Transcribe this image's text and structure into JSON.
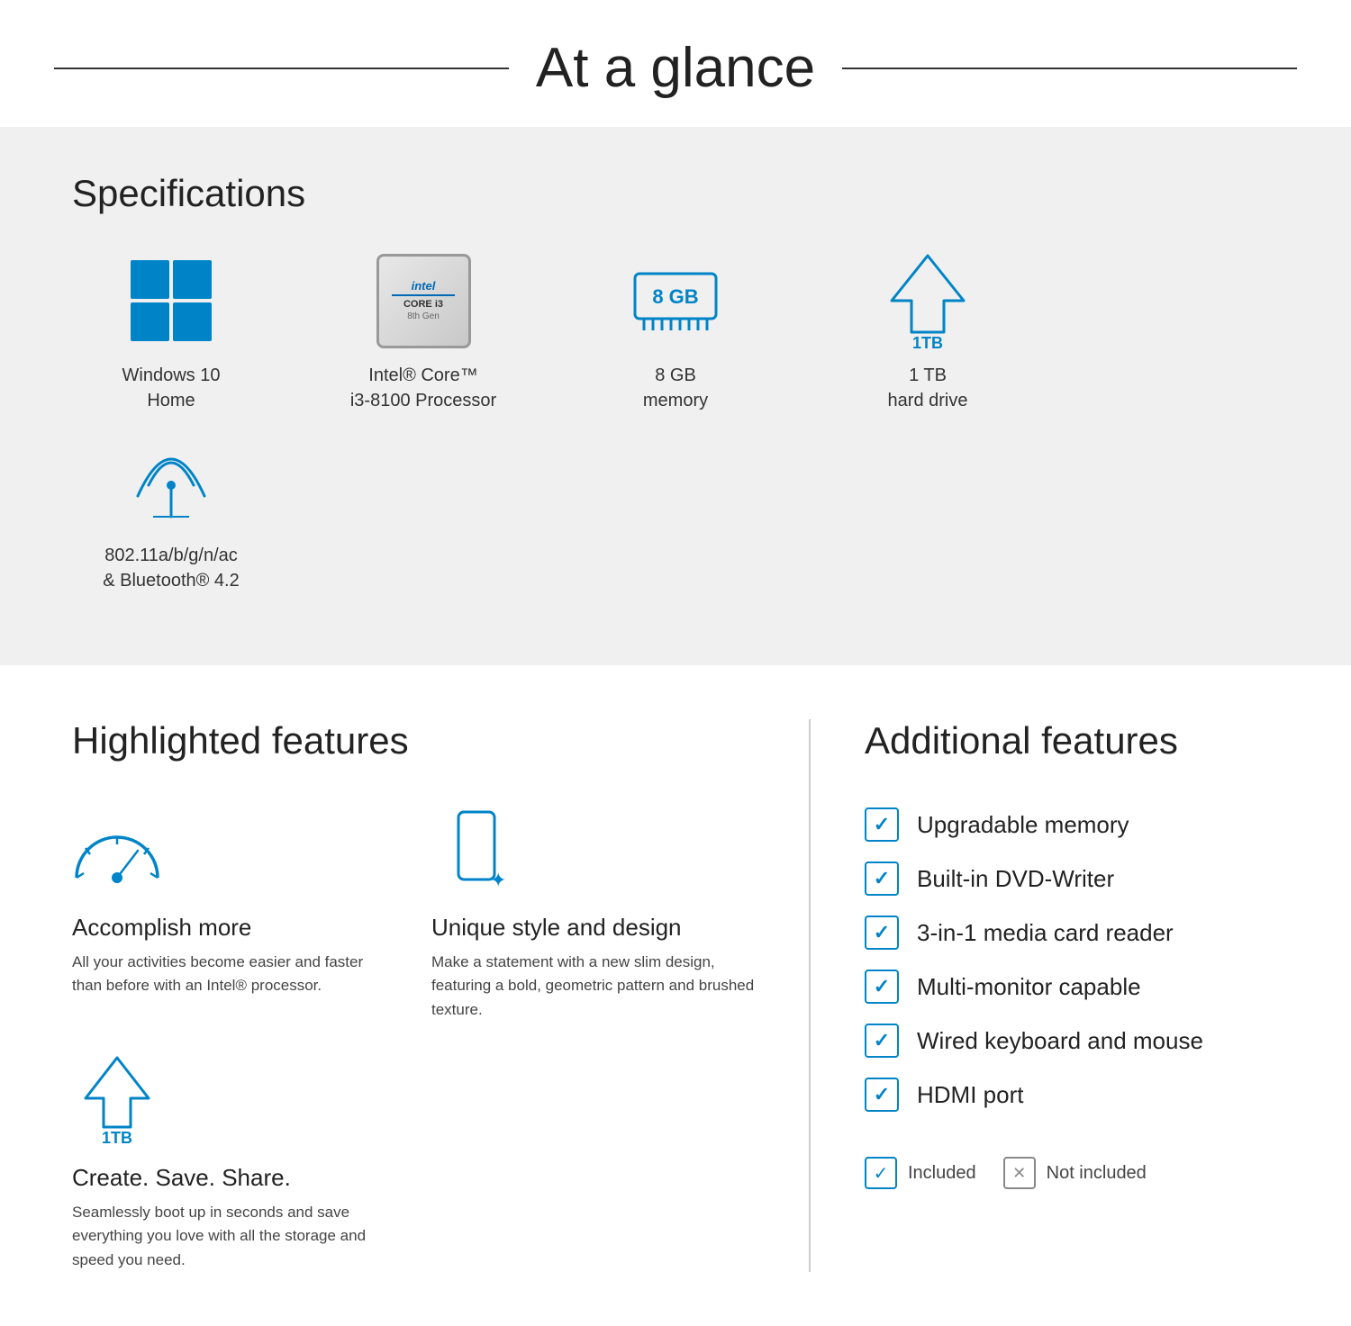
{
  "header": {
    "title": "At a glance"
  },
  "specs": {
    "section_title": "Specifications",
    "items": [
      {
        "id": "windows",
        "label": "Windows 10\nHome",
        "icon": "windows-icon"
      },
      {
        "id": "processor",
        "label": "Intel® Core™\ni3-8100 Processor",
        "icon": "intel-icon"
      },
      {
        "id": "memory",
        "label": "8 GB\nmemory",
        "icon": "ram-icon"
      },
      {
        "id": "storage",
        "label": "1 TB\nhard drive",
        "icon": "hdd-icon"
      },
      {
        "id": "wifi",
        "label": "802.11a/b/g/n/ac\n& Bluetooth® 4.2",
        "icon": "wifi-icon"
      }
    ]
  },
  "highlighted": {
    "section_title": "Highlighted features",
    "items": [
      {
        "id": "accomplish",
        "name": "Accomplish more",
        "desc": "All your activities become easier and faster than before with an Intel® processor.",
        "icon": "speedometer-icon"
      },
      {
        "id": "style",
        "name": "Unique style and design",
        "desc": "Make a statement with a new slim design, featuring a bold, geometric pattern and brushed texture.",
        "icon": "phone-icon"
      },
      {
        "id": "storage_feature",
        "name": "Create. Save. Share.",
        "desc": "Seamlessly boot up in seconds and save everything you love with all the storage and speed you need.",
        "icon": "tb-icon"
      }
    ]
  },
  "additional": {
    "section_title": "Additional features",
    "items": [
      "Upgradable memory",
      "Built-in DVD-Writer",
      "3-in-1 media card reader",
      "Multi-monitor capable",
      "Wired keyboard and mouse",
      "HDMI port"
    ],
    "legend": {
      "included_label": "Included",
      "not_included_label": "Not included"
    }
  },
  "intel": {
    "line1": "intel",
    "line2": "CORE i3",
    "line3": "8th Gen"
  },
  "ram": {
    "text": "8 GB"
  },
  "storage_label": "1TB"
}
